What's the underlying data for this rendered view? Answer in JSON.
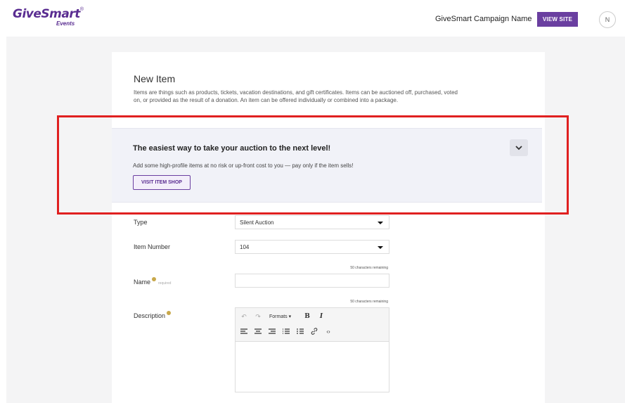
{
  "header": {
    "logo_main": "GiveSmart",
    "logo_tm": "®",
    "logo_sub": "Events",
    "campaign_name": "GiveSmart Campaign Name",
    "view_site_label": "VIEW SITE",
    "avatar_initial": "N"
  },
  "page": {
    "title": "New Item",
    "intro": "Items are things such as products, tickets, vacation destinations, and gift certificates. Items can be auctioned off, purchased, voted on, or provided as the result of a donation. An item can be offered individually or combined into a package."
  },
  "promo": {
    "title": "The easiest way to take your auction to the next level!",
    "text": "Add some high-profile items at no risk or up-front cost to you — pay only if the item sells!",
    "button_label": "VISIT ITEM SHOP",
    "collapse_icon": "chevron-down-icon"
  },
  "form": {
    "type_label": "Type",
    "type_value": "Silent Auction",
    "item_number_label": "Item Number",
    "item_number_value": "104",
    "name_label": "Name",
    "name_required": "required",
    "name_remaining": "50 characters remaining",
    "description_label": "Description",
    "description_remaining": "50 characters remaining",
    "editor": {
      "formats_label": "Formats",
      "bold": "B",
      "italic": "I"
    }
  },
  "colors": {
    "brand": "#6a3fa0",
    "highlight": "#e02020",
    "promo_bg": "#f1f2f8"
  }
}
